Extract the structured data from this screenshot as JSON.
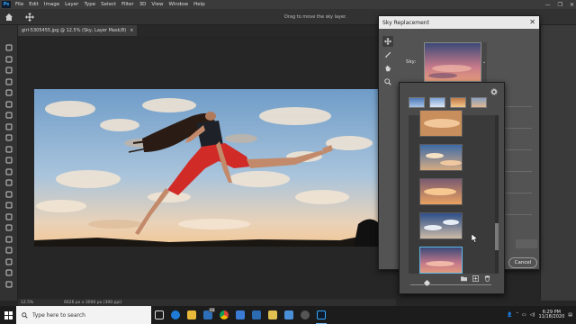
{
  "app": {
    "logo_text": "Ps",
    "menu": [
      "File",
      "Edit",
      "Image",
      "Layer",
      "Type",
      "Select",
      "Filter",
      "3D",
      "View",
      "Window",
      "Help"
    ],
    "window_controls": [
      "—",
      "❐",
      "✕"
    ]
  },
  "options_bar": {
    "status_hint": "Drag to move the sky layer."
  },
  "document": {
    "tab_title": "girl-5305455.jpg @ 12.5% (Sky, Layer Mask/8)",
    "tab_close": "×"
  },
  "status_bar": {
    "zoom": "12.5%",
    "info": "6626 px x 3000 px (300 ppi)"
  },
  "tools": [
    "move-icon",
    "marquee-icon",
    "lasso-icon",
    "quick-select-icon",
    "crop-icon",
    "frame-icon",
    "eyedropper-icon",
    "healing-icon",
    "brush-icon",
    "stamp-icon",
    "history-brush-icon",
    "eraser-icon",
    "gradient-icon",
    "blur-icon",
    "dodge-icon",
    "pen-icon",
    "type-icon",
    "path-select-icon",
    "rectangle-icon",
    "hand-icon",
    "zoom-icon",
    "more-icon"
  ],
  "sky_dialog": {
    "title": "Sky Replacement",
    "close": "✕",
    "sky_label": "Sky:",
    "dropdown_glyph": "⌄",
    "cancel_label": "Cancel"
  },
  "taskbar": {
    "search_placeholder": "Type here to search",
    "badge_count": "48",
    "time": "6:29 PM",
    "date": "11/18/2020"
  },
  "colors": {
    "accent_selection": "#5cb8e6",
    "app_bg": "#262626",
    "dialog_bg": "#535353"
  }
}
